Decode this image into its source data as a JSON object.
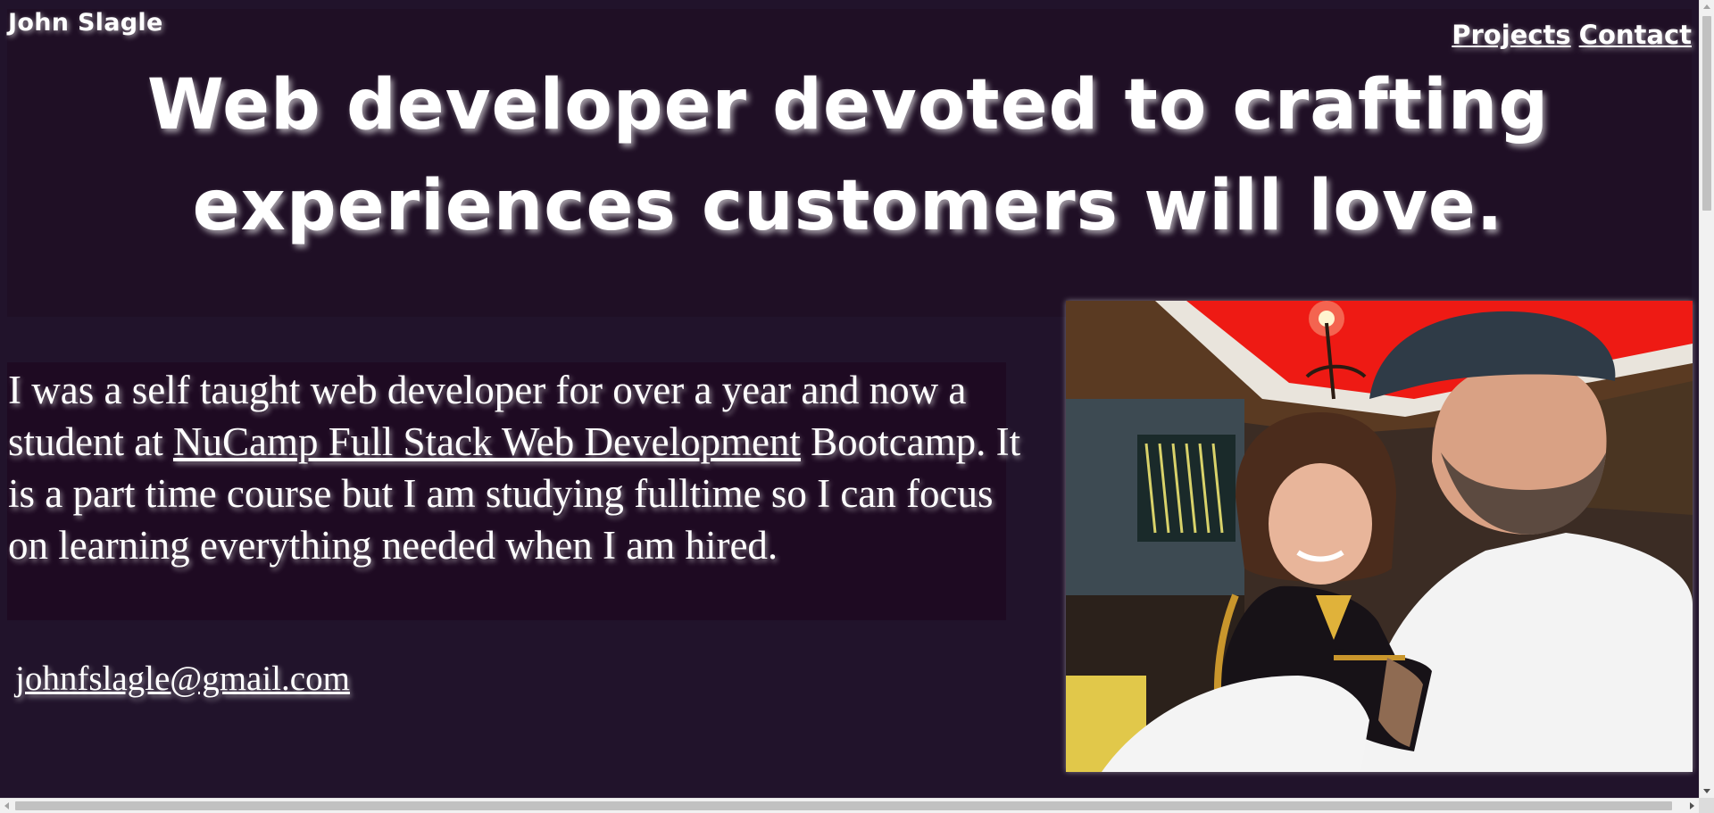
{
  "header": {
    "brand": "John Slagle",
    "nav": [
      {
        "label": "Projects"
      },
      {
        "label": "Contact"
      }
    ]
  },
  "hero": {
    "headline_line1": "Web developer devoted to crafting",
    "headline_line2": "experiences customers will love."
  },
  "about": {
    "text_before_link": "I was a self taught web developer for over a year and now a student at ",
    "link_text": "NuCamp Full Stack Web Development",
    "text_after_link": " Bootcamp. It is a part time course but I am studying fulltime so I can focus on learning everything needed when I am hired."
  },
  "contact": {
    "email": "johnfslagle@gmail.com"
  },
  "photo": {
    "subject": "selfie-of-man-in-cap-with-young-girl-in-restaurant"
  },
  "colors": {
    "page_background": "#21132b",
    "hero_background": "#1f0f25",
    "about_background": "#1e0a22",
    "text": "#ffffff"
  },
  "scroll": {
    "vertical_thumb_fraction": 0.25,
    "horizontal_thumb_fraction": 0.98
  }
}
